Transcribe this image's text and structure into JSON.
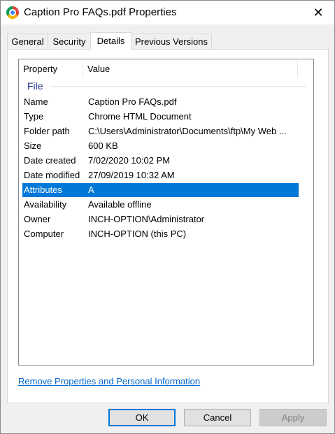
{
  "window": {
    "title": "Caption Pro FAQs.pdf Properties",
    "close_glyph": "✕"
  },
  "tabs": [
    {
      "label": "General",
      "active": false
    },
    {
      "label": "Security",
      "active": false
    },
    {
      "label": "Details",
      "active": true
    },
    {
      "label": "Previous Versions",
      "active": false
    }
  ],
  "details": {
    "columns": {
      "property": "Property",
      "value": "Value"
    },
    "group": "File",
    "rows": [
      {
        "property": "Name",
        "value": "Caption Pro FAQs.pdf"
      },
      {
        "property": "Type",
        "value": "Chrome HTML Document"
      },
      {
        "property": "Folder path",
        "value": "C:\\Users\\Administrator\\Documents\\ftp\\My Web ..."
      },
      {
        "property": "Size",
        "value": "600 KB"
      },
      {
        "property": "Date created",
        "value": "7/02/2020 10:02 PM"
      },
      {
        "property": "Date modified",
        "value": "27/09/2019 10:32 AM"
      },
      {
        "property": "Attributes",
        "value": "A",
        "selected": true
      },
      {
        "property": "Availability",
        "value": "Available offline"
      },
      {
        "property": "Owner",
        "value": "INCH-OPTION\\Administrator"
      },
      {
        "property": "Computer",
        "value": "INCH-OPTION (this PC)"
      }
    ]
  },
  "link": "Remove Properties and Personal Information",
  "buttons": {
    "ok": "OK",
    "cancel": "Cancel",
    "apply": "Apply"
  },
  "colors": {
    "selection": "#0078d7",
    "link": "#0066cc",
    "group_text": "#1e3287"
  },
  "icons": {
    "app": "chrome-icon",
    "close": "close-icon"
  }
}
